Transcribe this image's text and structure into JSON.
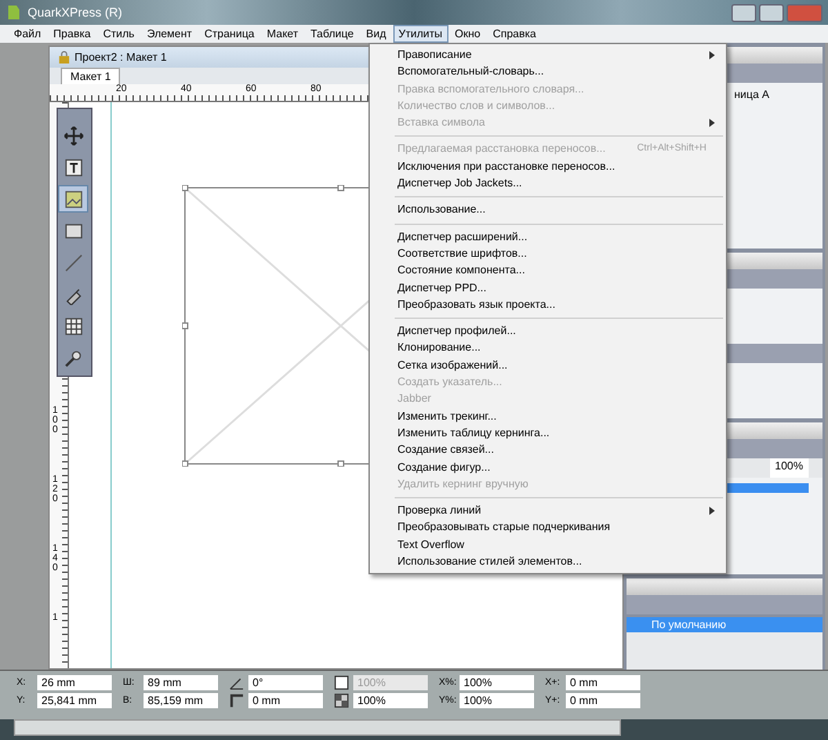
{
  "window": {
    "title": "QuarkXPress (R)"
  },
  "menubar": [
    {
      "label": "Файл",
      "selected": false
    },
    {
      "label": "Правка",
      "selected": false
    },
    {
      "label": "Стиль",
      "selected": false
    },
    {
      "label": "Элемент",
      "selected": false
    },
    {
      "label": "Страница",
      "selected": false
    },
    {
      "label": "Макет",
      "selected": false
    },
    {
      "label": "Таблице",
      "selected": false
    },
    {
      "label": "Вид",
      "selected": false
    },
    {
      "label": "Утилиты",
      "selected": true
    },
    {
      "label": "Окно",
      "selected": false
    },
    {
      "label": "Справка",
      "selected": false
    }
  ],
  "document": {
    "title": "Проект2 : Макет 1",
    "tabs": [
      {
        "label": "Макет 1",
        "selected": true
      }
    ],
    "ruler_h": [
      "20",
      "40",
      "60",
      "80"
    ],
    "ruler_v": [
      "100",
      "120",
      "140",
      "1"
    ],
    "tools": [
      {
        "kind": "move",
        "selected": false
      },
      {
        "kind": "text",
        "selected": false
      },
      {
        "kind": "picture",
        "selected": true
      },
      {
        "kind": "box",
        "selected": false
      },
      {
        "kind": "line",
        "selected": false
      },
      {
        "kind": "pen",
        "selected": false
      },
      {
        "kind": "table",
        "selected": false
      },
      {
        "kind": "zoom",
        "selected": false
      }
    ]
  },
  "menu": {
    "items": [
      {
        "kind": "item",
        "label": "Правописание",
        "disabled": false,
        "submenu": true
      },
      {
        "kind": "item",
        "label": "Вспомогательный-словарь...",
        "disabled": false,
        "submenu": false
      },
      {
        "kind": "item",
        "label": "Правка вспомогательного словаря...",
        "disabled": true,
        "submenu": false
      },
      {
        "kind": "item",
        "label": "Количество слов и символов...",
        "disabled": true,
        "submenu": false
      },
      {
        "kind": "item",
        "label": "Вставка символа",
        "disabled": true,
        "submenu": true
      },
      {
        "kind": "separator"
      },
      {
        "kind": "item",
        "label": "Предлагаемая расстановка переносов...",
        "disabled": true,
        "submenu": false,
        "shortcut": "Ctrl+Alt+Shift+H"
      },
      {
        "kind": "item",
        "label": "Исключения при расстановке переносов...",
        "disabled": false,
        "submenu": false
      },
      {
        "kind": "item",
        "label": "Диспетчер Job Jackets...",
        "disabled": false,
        "submenu": false
      },
      {
        "kind": "separator"
      },
      {
        "kind": "item",
        "label": "Использование...",
        "disabled": false,
        "submenu": false
      },
      {
        "kind": "separator"
      },
      {
        "kind": "item",
        "label": "Диспетчер расширений...",
        "disabled": false,
        "submenu": false
      },
      {
        "kind": "item",
        "label": "Соответствие шрифтов...",
        "disabled": false,
        "submenu": false
      },
      {
        "kind": "item",
        "label": "Состояние компонента...",
        "disabled": false,
        "submenu": false
      },
      {
        "kind": "item",
        "label": "Диспетчер PPD...",
        "disabled": false,
        "submenu": false
      },
      {
        "kind": "item",
        "label": "Преобразовать язык проекта...",
        "disabled": false,
        "submenu": false
      },
      {
        "kind": "separator"
      },
      {
        "kind": "item",
        "label": "Диспетчер профилей...",
        "disabled": false,
        "submenu": false
      },
      {
        "kind": "item",
        "label": "Клонирование...",
        "disabled": false,
        "submenu": false
      },
      {
        "kind": "item",
        "label": "Сетка изображений...",
        "disabled": false,
        "submenu": false
      },
      {
        "kind": "item",
        "label": "Создать указатель...",
        "disabled": true,
        "submenu": false
      },
      {
        "kind": "item",
        "label": "Jabber",
        "disabled": true,
        "submenu": false
      },
      {
        "kind": "item",
        "label": "Изменить трекинг...",
        "disabled": false,
        "submenu": false
      },
      {
        "kind": "item",
        "label": "Изменить таблицу кернинга...",
        "disabled": false,
        "submenu": false
      },
      {
        "kind": "item",
        "label": "Создание связей...",
        "disabled": false,
        "submenu": false
      },
      {
        "kind": "item",
        "label": "Создание фигур...",
        "disabled": false,
        "submenu": false
      },
      {
        "kind": "item",
        "label": "Удалить кернинг вручную",
        "disabled": true,
        "submenu": false
      },
      {
        "kind": "separator"
      },
      {
        "kind": "item",
        "label": "Проверка линий",
        "disabled": false,
        "submenu": true
      },
      {
        "kind": "item",
        "label": "Преобразовывать старые подчеркивания",
        "disabled": false,
        "submenu": false
      },
      {
        "kind": "item",
        "label": "Text Overflow",
        "disabled": false,
        "submenu": false
      },
      {
        "kind": "item",
        "label": "Использование стилей элементов...",
        "disabled": false,
        "submenu": false
      }
    ]
  },
  "panels": {
    "page_label": "ница А",
    "zoom": "100%",
    "style_row": {
      "label": "По умолчанию",
      "selected": true
    }
  },
  "measurements": [
    [
      {
        "kind": "text",
        "label": "X:",
        "value": "26 mm",
        "disabled": false
      },
      {
        "kind": "text",
        "label": "Y:",
        "value": "25,841 mm",
        "disabled": false
      }
    ],
    [
      {
        "kind": "text",
        "label": "Ш:",
        "value": "89 mm",
        "disabled": false
      },
      {
        "kind": "text",
        "label": "В:",
        "value": "85,159 mm",
        "disabled": false
      }
    ],
    [
      {
        "kind": "angle",
        "value": "0°",
        "disabled": false
      },
      {
        "kind": "corner",
        "value": "0 mm",
        "disabled": false
      }
    ],
    [
      {
        "kind": "shade",
        "value": "100%",
        "disabled": true
      },
      {
        "kind": "opacity",
        "value": "100%",
        "disabled": false
      }
    ],
    [
      {
        "kind": "text",
        "label": "X%:",
        "value": "100%",
        "disabled": false
      },
      {
        "kind": "text",
        "label": "Y%:",
        "value": "100%",
        "disabled": false
      }
    ],
    [
      {
        "kind": "text",
        "label": "X+:",
        "value": "0 mm",
        "disabled": false
      },
      {
        "kind": "text",
        "label": "Y+:",
        "value": "0 mm",
        "disabled": false
      }
    ]
  ]
}
